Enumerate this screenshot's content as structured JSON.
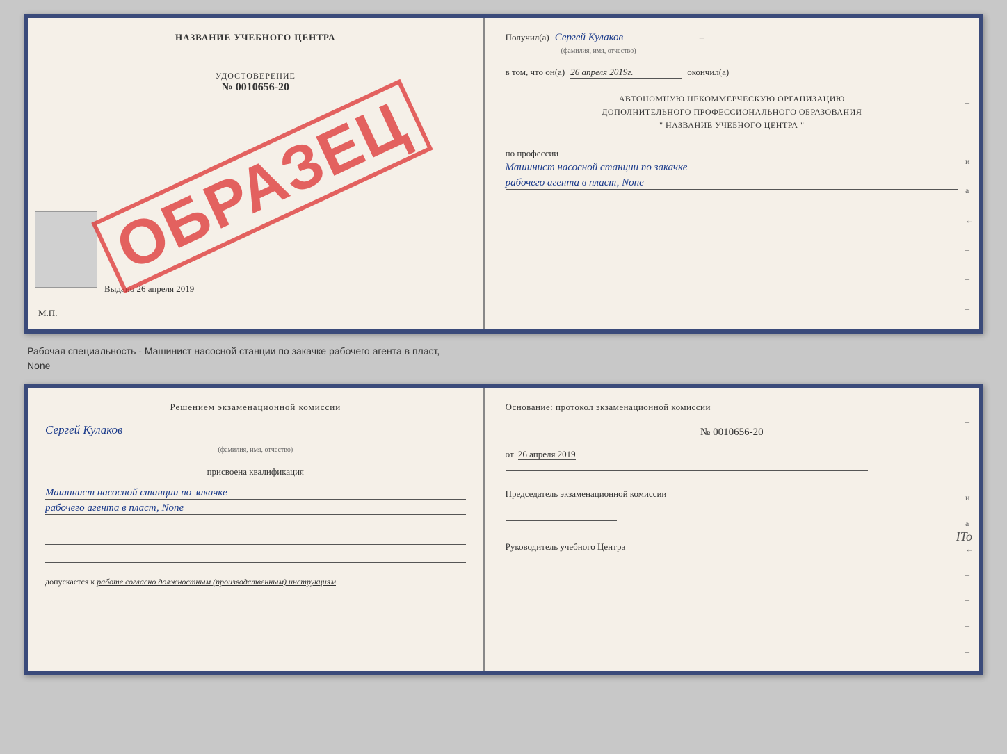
{
  "top_doc": {
    "left": {
      "title": "НАЗВАНИЕ УЧЕБНОГО ЦЕНТРА",
      "cert_label": "УДОСТОВЕРЕНИЕ",
      "cert_number": "№ 0010656-20",
      "issued_label": "Выдано",
      "issued_date": "26 апреля 2019",
      "mp_label": "М.П.",
      "obrazets": "ОБРАЗЕЦ"
    },
    "right": {
      "received_label": "Получил(а)",
      "received_name": "Сергей Кулаков",
      "name_hint": "(фамилия, имя, отчество)",
      "date_prefix": "в том, что он(а)",
      "date_value": "26 апреля 2019г.",
      "date_suffix": "окончил(а)",
      "org_line1": "АВТОНОМНУЮ НЕКОММЕРЧЕСКУЮ ОРГАНИЗАЦИЮ",
      "org_line2": "ДОПОЛНИТЕЛЬНОГО ПРОФЕССИОНАЛЬНОГО ОБРАЗОВАНИЯ",
      "org_line3": "\" НАЗВАНИЕ УЧЕБНОГО ЦЕНТРА \"",
      "profession_label": "по профессии",
      "profession_line1": "Машинист насосной станции по закачке",
      "profession_line2": "рабочего агента в пласт, None"
    }
  },
  "caption": {
    "line1": "Рабочая специальность - Машинист насосной станции по закачке рабочего агента в пласт,",
    "line2": "None"
  },
  "bottom_doc": {
    "left": {
      "commission_text": "Решением экзаменационной комиссии",
      "person_name": "Сергей Кулаков",
      "name_hint": "(фамилия, имя, отчество)",
      "qualification_label": "присвоена квалификация",
      "qualification_line1": "Машинист насосной станции по закачке",
      "qualification_line2": "рабочего агента в пласт, None",
      "допускается_prefix": "допускается к",
      "допускается_value": "работе согласно должностным (производственным) инструкциям"
    },
    "right": {
      "basis_label": "Основание: протокол экзаменационной комиссии",
      "protocol_number": "№ 0010656-20",
      "date_prefix": "от",
      "date_value": "26 апреля 2019",
      "chairman_label": "Председатель экзаменационной комиссии",
      "director_label": "Руководитель учебного Центра"
    }
  },
  "dashes": [
    "-",
    "-",
    "-",
    "и",
    "а",
    "←",
    "-",
    "-",
    "-",
    "-"
  ]
}
